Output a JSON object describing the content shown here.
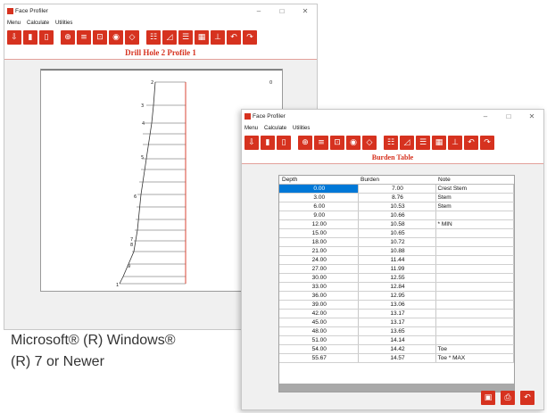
{
  "back_window": {
    "title": "Face Profiler",
    "menu": [
      "Menu",
      "Calculate",
      "Utilities"
    ],
    "header": "Drill Hole 2  Profile 1",
    "chart_labels": [
      "2",
      "3",
      "4",
      "5",
      "6",
      "7",
      "8",
      "9",
      "1",
      "0"
    ]
  },
  "front_window": {
    "title": "Face Profiler",
    "menu": [
      "Menu",
      "Calculate",
      "Utilities"
    ],
    "header": "Burden Table",
    "columns": [
      "Depth",
      "Burden",
      "Note"
    ],
    "rows": [
      [
        "0.00",
        "7.00",
        "Crest Stem"
      ],
      [
        "3.00",
        "8.76",
        "Stem"
      ],
      [
        "6.00",
        "10.53",
        "Stem"
      ],
      [
        "9.00",
        "10.66",
        ""
      ],
      [
        "12.00",
        "10.58",
        "* MIN"
      ],
      [
        "15.00",
        "10.65",
        ""
      ],
      [
        "18.00",
        "10.72",
        ""
      ],
      [
        "21.00",
        "10.88",
        ""
      ],
      [
        "24.00",
        "11.44",
        ""
      ],
      [
        "27.00",
        "11.99",
        ""
      ],
      [
        "30.00",
        "12.55",
        ""
      ],
      [
        "33.00",
        "12.84",
        ""
      ],
      [
        "36.00",
        "12.95",
        ""
      ],
      [
        "39.00",
        "13.06",
        ""
      ],
      [
        "42.00",
        "13.17",
        ""
      ],
      [
        "45.00",
        "13.17",
        ""
      ],
      [
        "48.00",
        "13.65",
        ""
      ],
      [
        "51.00",
        "14.14",
        ""
      ],
      [
        "54.00",
        "14.42",
        "Toe"
      ],
      [
        "55.67",
        "14.57",
        "Toe * MAX"
      ]
    ]
  },
  "caption": {
    "line1": "Microsoft® (R) Windows®",
    "line2": "(R) 7 or Newer"
  },
  "colors": {
    "accent": "#d6321f",
    "selection": "#0078d7"
  }
}
